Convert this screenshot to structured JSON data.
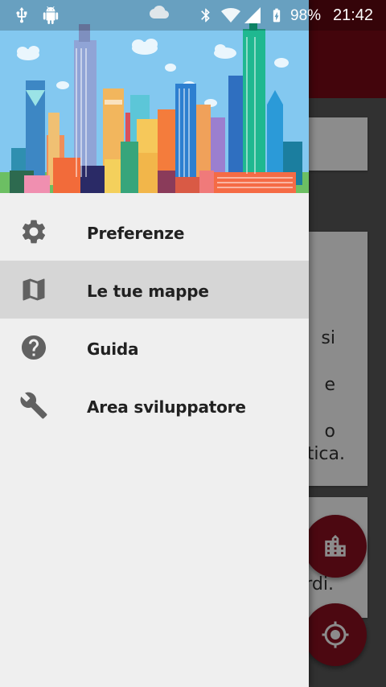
{
  "status_bar": {
    "battery_percent": "98%",
    "time": "21:42"
  },
  "background": {
    "card2_lines": [
      "si",
      "e",
      "o",
      "tica."
    ],
    "card3_line": "rdi."
  },
  "drawer": {
    "menu": [
      {
        "label": "Preferenze",
        "icon": "gear-icon",
        "selected": false
      },
      {
        "label": "Le tue mappe",
        "icon": "map-icon",
        "selected": true
      },
      {
        "label": "Guida",
        "icon": "help-icon",
        "selected": false
      },
      {
        "label": "Area sviluppatore",
        "icon": "wrench-icon",
        "selected": false
      }
    ]
  },
  "colors": {
    "toolbar": "#7a0a17",
    "fab": "#8a0f20",
    "drawer_bg": "#efefef",
    "selected_item": "#d6d6d6",
    "sky": "#83c8f0"
  }
}
